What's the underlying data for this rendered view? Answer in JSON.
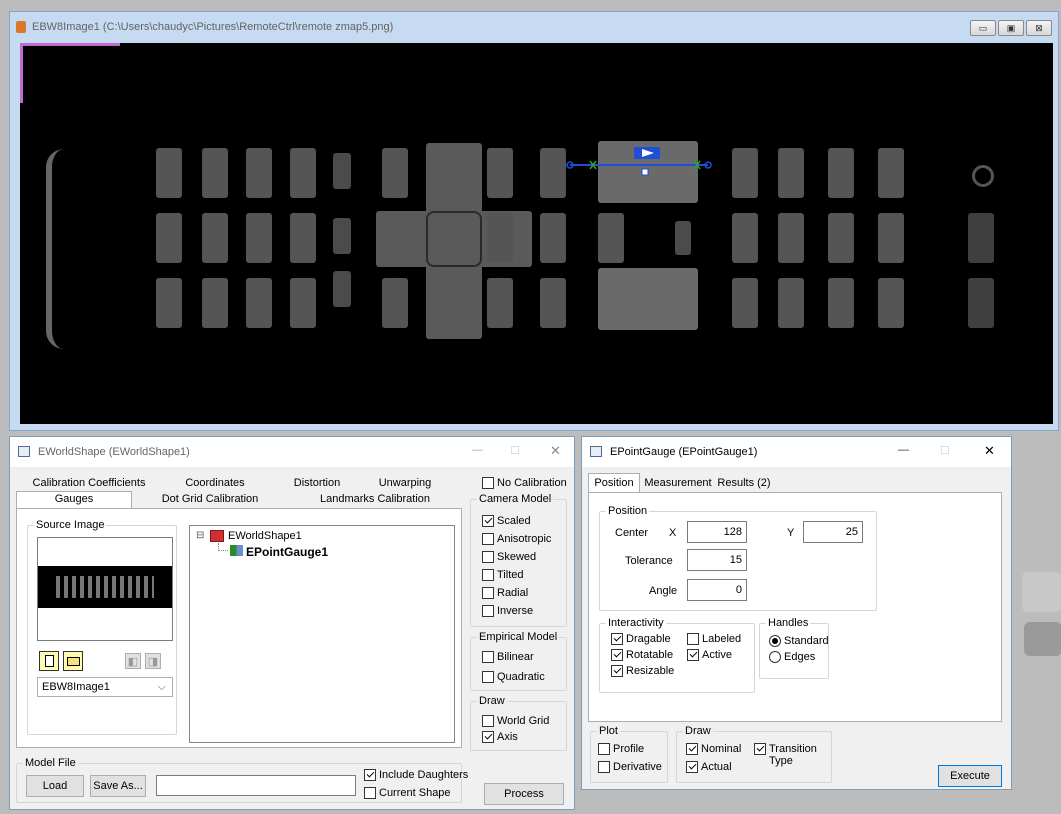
{
  "image_window": {
    "title": "EBW8Image1 (C:\\Users\\chaudyc\\Pictures\\RemoteCtrl\\remote zmap5.png)",
    "buttons": {
      "minimize": "▭",
      "maximize": "▣",
      "close": "⊠"
    }
  },
  "world_shape": {
    "title": "EWorldShape (EWorldShape1)",
    "controls": {
      "minimize": "—",
      "maximize": "☐",
      "close": "✕"
    },
    "tabs_row1": [
      "Calibration Coefficients",
      "Coordinates",
      "Distortion",
      "Unwarping"
    ],
    "tabs_row2": [
      "Gauges",
      "Dot Grid Calibration",
      "Landmarks Calibration"
    ],
    "source_image_label": "Source Image",
    "source_select": "EBW8Image1",
    "tree": {
      "root": "EWorldShape1",
      "child": "EPointGauge1",
      "expand": "⊟"
    },
    "no_calibration": "No Calibration",
    "camera_model": {
      "label": "Camera Model",
      "items": [
        {
          "label": "Scaled",
          "checked": true
        },
        {
          "label": "Anisotropic",
          "checked": false
        },
        {
          "label": "Skewed",
          "checked": false
        },
        {
          "label": "Tilted",
          "checked": false
        },
        {
          "label": "Radial",
          "checked": false
        },
        {
          "label": "Inverse",
          "checked": false
        }
      ]
    },
    "empirical_model": {
      "label": "Empirical Model",
      "items": [
        {
          "label": "Bilinear",
          "checked": false
        },
        {
          "label": "Quadratic",
          "checked": false
        }
      ]
    },
    "draw": {
      "label": "Draw",
      "items": [
        {
          "label": "World Grid",
          "checked": false
        },
        {
          "label": "Axis",
          "checked": true
        }
      ]
    },
    "model_file": {
      "label": "Model File",
      "load": "Load",
      "save_as": "Save As...",
      "path": "",
      "include_daughters": "Include Daughters",
      "current_shape": "Current Shape"
    },
    "process": "Process"
  },
  "point_gauge": {
    "title": "EPointGauge (EPointGauge1)",
    "controls": {
      "minimize": "—",
      "maximize": "☐",
      "close": "✕"
    },
    "tabs": [
      "Position",
      "Measurement",
      "Results (2)"
    ],
    "position": {
      "label": "Position",
      "center": "Center",
      "x_label": "X",
      "x": "128",
      "y_label": "Y",
      "y": "25",
      "tolerance_label": "Tolerance",
      "tolerance": "15",
      "angle_label": "Angle",
      "angle": "0"
    },
    "interactivity": {
      "label": "Interactivity",
      "dragable": "Dragable",
      "labeled": "Labeled",
      "rotatable": "Rotatable",
      "active": "Active",
      "resizable": "Resizable"
    },
    "handles": {
      "label": "Handles",
      "standard": "Standard",
      "edges": "Edges"
    },
    "plot": {
      "label": "Plot",
      "profile": "Profile",
      "derivative": "Derivative"
    },
    "draw": {
      "label": "Draw",
      "nominal": "Nominal",
      "actual": "Actual",
      "transition_type": "Transition Type"
    },
    "execute": "Execute"
  },
  "colors": {
    "accent": "#1f4fd8",
    "titlebar_inactive": "#bfd7ef",
    "image_bg": "#000000"
  }
}
